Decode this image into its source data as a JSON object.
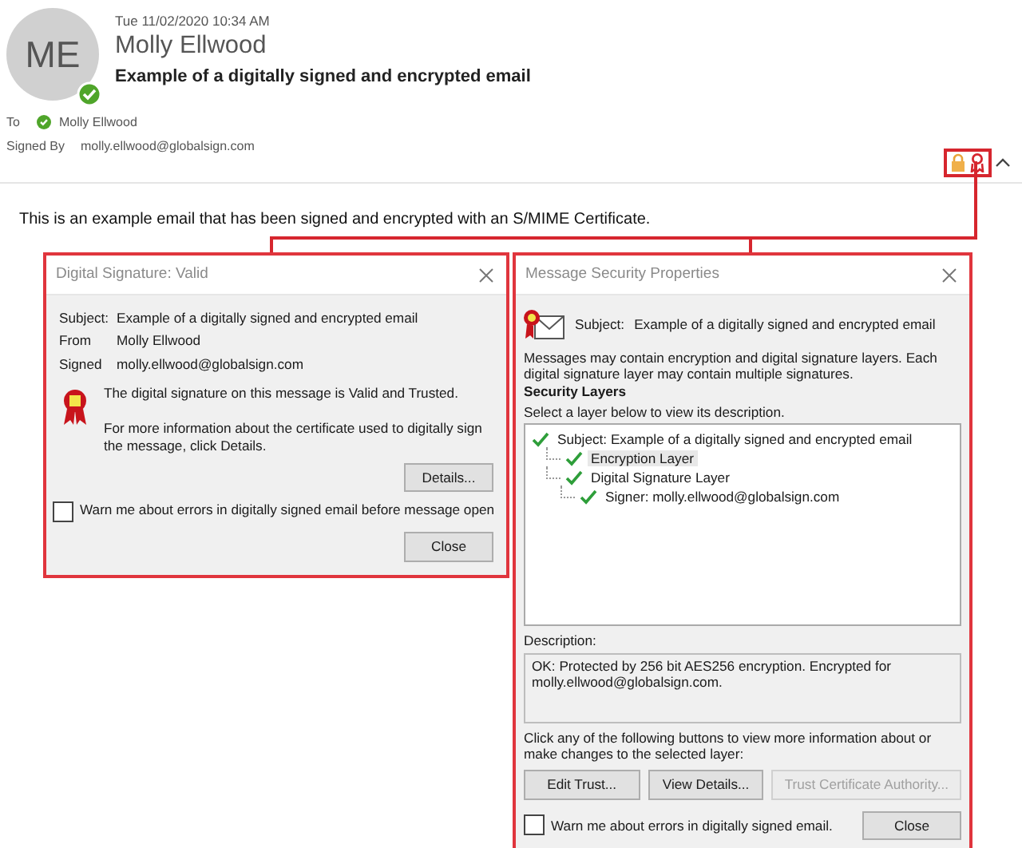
{
  "message": {
    "date": "Tue 11/02/2020 10:34 AM",
    "avatar_initials": "ME",
    "sender": "Molly Ellwood",
    "subject": "Example of a digitally signed and encrypted email",
    "to_label": "To",
    "to": "Molly Ellwood",
    "signed_by_label": "Signed By",
    "signed_by": "molly.ellwood@globalsign.com",
    "body": "This is an example email that has been signed and encrypted with an S/MIME Certificate."
  },
  "signature_dialog": {
    "title": "Digital Signature: Valid",
    "fields": [
      {
        "label": "Subject:",
        "value": "Example of a digitally signed and encrypted email"
      },
      {
        "label": "From",
        "value": "Molly Ellwood"
      },
      {
        "label": "Signed",
        "value": "molly.ellwood@globalsign.com"
      }
    ],
    "status": "The digital signature on this message is Valid and Trusted.",
    "info": "For more information about the certificate used to digitally sign the message, click Details.",
    "details_button": "Details...",
    "warn_checkbox": {
      "label": "Warn me about errors in digitally signed email before message open",
      "checked": false
    },
    "close_button": "Close"
  },
  "security_dialog": {
    "title": "Message Security Properties",
    "subject_label": "Subject:",
    "subject": "Example of a digitally signed and encrypted email",
    "intro": "Messages may contain encryption and digital signature layers. Each digital signature layer may contain multiple signatures.",
    "layers_heading": "Security Layers",
    "layers_hint": "Select a layer below to view its description.",
    "layers": [
      {
        "label": "Subject: Example of a digitally signed and encrypted email",
        "selected": false,
        "children": [
          {
            "label": "Encryption Layer",
            "selected": true
          },
          {
            "label": "Digital Signature Layer",
            "selected": false,
            "children": [
              {
                "label": "Signer: molly.ellwood@globalsign.com",
                "selected": false
              }
            ]
          }
        ]
      }
    ],
    "description_label": "Description:",
    "description": "OK: Protected by 256 bit AES256 encryption. Encrypted for molly.ellwood@globalsign.com.",
    "buttons_hint": "Click any of the following buttons to view more information about or make changes to the selected layer:",
    "buttons": [
      {
        "label": "Edit Trust...",
        "disabled": false
      },
      {
        "label": "View Details...",
        "disabled": false
      },
      {
        "label": "Trust Certificate Authority...",
        "disabled": true
      }
    ],
    "warn_checkbox": {
      "label": "Warn me about errors in digitally signed email.",
      "checked": false
    },
    "close_button": "Close"
  }
}
